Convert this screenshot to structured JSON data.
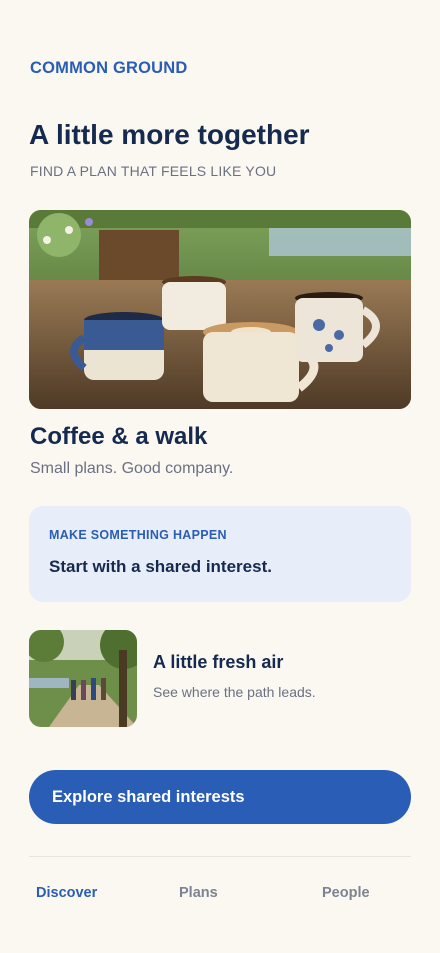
{
  "app": {
    "brand": "COMMON GROUND"
  },
  "hero": {
    "headline": "A little more together",
    "subhead": "FIND A PLAN THAT FEELS LIKE YOU"
  },
  "feature": {
    "title": "Coffee & a walk",
    "subtitle": "Small plans. Good company."
  },
  "callout": {
    "kicker": "MAKE SOMETHING HAPPEN",
    "text": "Start with a shared interest."
  },
  "item": {
    "title": "A little fresh air",
    "subtitle": "See where the path leads."
  },
  "cta": {
    "label": "Explore shared interests"
  },
  "nav": {
    "items": [
      {
        "label": "Discover",
        "active": true
      },
      {
        "label": "Plans",
        "active": false
      },
      {
        "label": "People",
        "active": false
      }
    ]
  },
  "colors": {
    "background": "#fbf8f1",
    "accent": "#2a5db5",
    "heading": "#152a4e",
    "muted": "#6b7182",
    "callout_bg": "#e8eef9"
  }
}
